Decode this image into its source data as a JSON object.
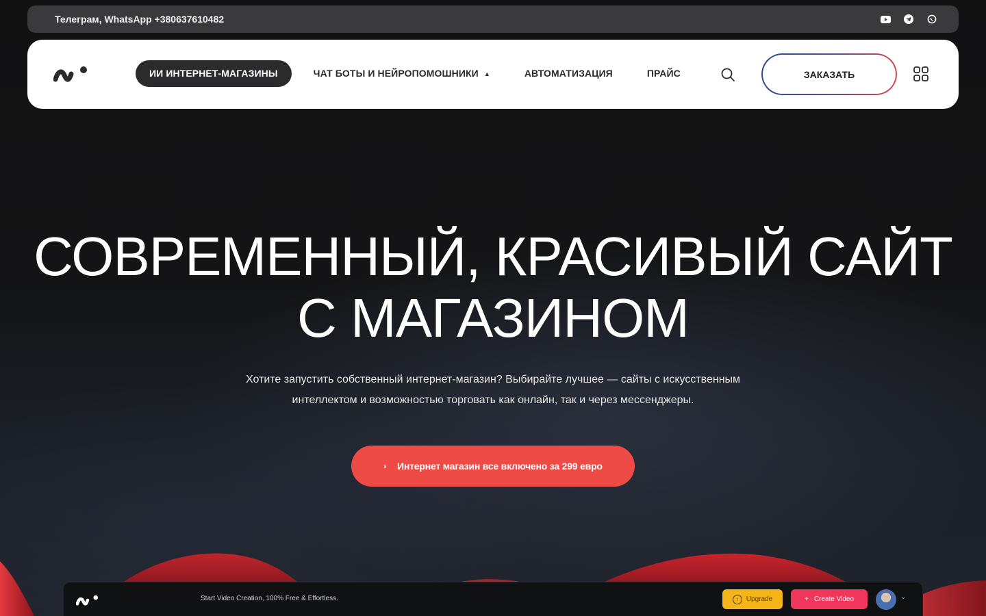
{
  "topbar": {
    "contact": "Телеграм, WhatsApp +380637610482",
    "socials": [
      "youtube-icon",
      "telegram-icon",
      "whatsapp-icon"
    ]
  },
  "nav": {
    "items": [
      {
        "label": "ИИ ИНТЕРНЕТ-МАГАЗИНЫ",
        "active": true
      },
      {
        "label": "ЧАТ БОТЫ И НЕЙРОПОМОШНИКИ",
        "has_dropdown": true
      },
      {
        "label": "АВТОМАТИЗАЦИЯ"
      },
      {
        "label": "ПРАЙС"
      }
    ],
    "order_label": "ЗАКАЗАТЬ"
  },
  "hero": {
    "title_line1": "СОВРЕМЕННЫЙ, КРАСИВЫЙ САЙТ",
    "title_line2": "С МАГАЗИНОМ",
    "subtitle_line1": "Хотите запустить собственный интернет-магазин? Выбирайте лучшее — сайты с искусственным",
    "subtitle_line2": "интеллектом и возможностью торговать как онлайн, так и через мессенджеры.",
    "cta_label": "Интернет магазин все включено за 299 евро"
  },
  "preview": {
    "tagline": "Start Video Creation, 100% Free & Effortless.",
    "upgrade_label": "Upgrade",
    "create_label": "Create Video"
  },
  "colors": {
    "accent": "#ee4b47",
    "background": "#121213",
    "nav_bg": "#ffffff",
    "topbar_bg": "#3a3a3c",
    "upgrade": "#f4b41a",
    "create": "#f0375b"
  }
}
